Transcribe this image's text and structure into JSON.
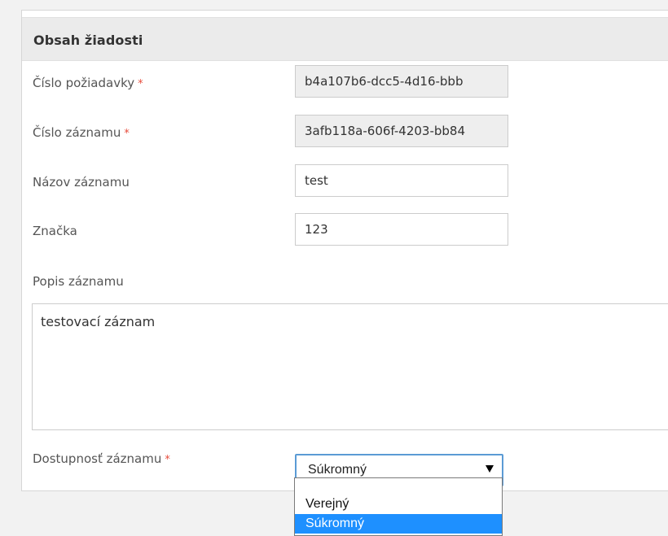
{
  "section": {
    "title": "Obsah žiadosti"
  },
  "fields": {
    "request_number": {
      "label": "Číslo požiadavky",
      "required_mark": "*",
      "value": "b4a107b6-dcc5-4d16-bbb"
    },
    "record_number": {
      "label": "Číslo záznamu",
      "required_mark": "*",
      "value": "3afb118a-606f-4203-bb84"
    },
    "record_name": {
      "label": "Názov záznamu",
      "value": "test"
    },
    "mark": {
      "label": "Značka",
      "value": "123"
    },
    "description": {
      "label": "Popis záznamu",
      "value": "testovací záznam"
    },
    "availability": {
      "label": "Dostupnosť záznamu",
      "required_mark": "*",
      "selected": "Súkromný",
      "options": [
        "Verejný",
        "Súkromný"
      ]
    }
  },
  "colors": {
    "required": "#e74c3c",
    "focus_border": "#5b9bd5",
    "option_highlight": "#1e90ff"
  }
}
